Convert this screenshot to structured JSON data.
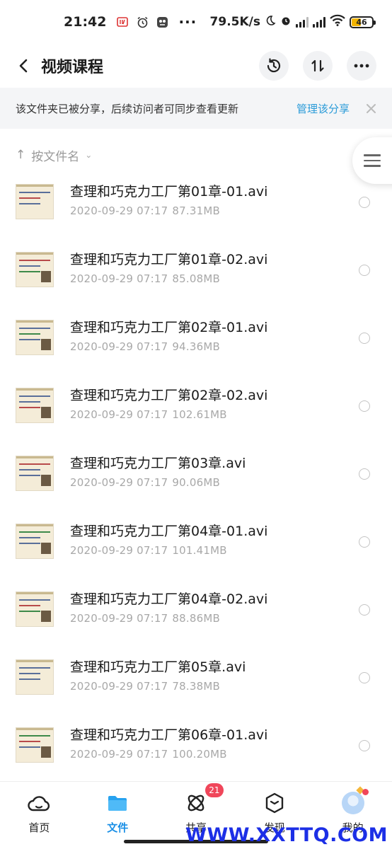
{
  "status_bar": {
    "time": "21:42",
    "network_speed": "79.5K/s",
    "battery": "46",
    "battery_level": 0.46,
    "more": "···"
  },
  "header": {
    "title": "视频课程",
    "icons": [
      "back-icon",
      "history-icon",
      "sort-toggle-icon",
      "more-icon"
    ]
  },
  "share_banner": {
    "text": "该文件夹已被分享，后续访问者可同步查看更新",
    "link": "管理该分享"
  },
  "sort": {
    "label": "按文件名"
  },
  "files": [
    {
      "name": "查理和巧克力工厂第01章-01.avi",
      "date": "2020-09-29",
      "time": "07:17",
      "size": "87.31MB"
    },
    {
      "name": "查理和巧克力工厂第01章-02.avi",
      "date": "2020-09-29",
      "time": "07:17",
      "size": "85.08MB"
    },
    {
      "name": "查理和巧克力工厂第02章-01.avi",
      "date": "2020-09-29",
      "time": "07:17",
      "size": "94.36MB"
    },
    {
      "name": "查理和巧克力工厂第02章-02.avi",
      "date": "2020-09-29",
      "time": "07:17",
      "size": "102.61MB"
    },
    {
      "name": "查理和巧克力工厂第03章.avi",
      "date": "2020-09-29",
      "time": "07:17",
      "size": "90.06MB"
    },
    {
      "name": "查理和巧克力工厂第04章-01.avi",
      "date": "2020-09-29",
      "time": "07:17",
      "size": "101.41MB"
    },
    {
      "name": "查理和巧克力工厂第04章-02.avi",
      "date": "2020-09-29",
      "time": "07:17",
      "size": "88.86MB"
    },
    {
      "name": "查理和巧克力工厂第05章.avi",
      "date": "2020-09-29",
      "time": "07:17",
      "size": "78.38MB"
    },
    {
      "name": "查理和巧克力工厂第06章-01.avi",
      "date": "2020-09-29",
      "time": "07:17",
      "size": "100.20MB"
    }
  ],
  "bottom_nav": {
    "items": [
      {
        "label": "首页",
        "icon": "home-cloud-icon"
      },
      {
        "label": "文件",
        "icon": "folder-icon"
      },
      {
        "label": "共享",
        "icon": "share-orbit-icon",
        "badge": "21"
      },
      {
        "label": "发现",
        "icon": "discover-box-icon"
      },
      {
        "label": "我的",
        "icon": "avatar-icon"
      }
    ],
    "active_index": 1,
    "active_color": "#1a8fe6"
  },
  "watermark": "WWW.XXTTQ.COM"
}
